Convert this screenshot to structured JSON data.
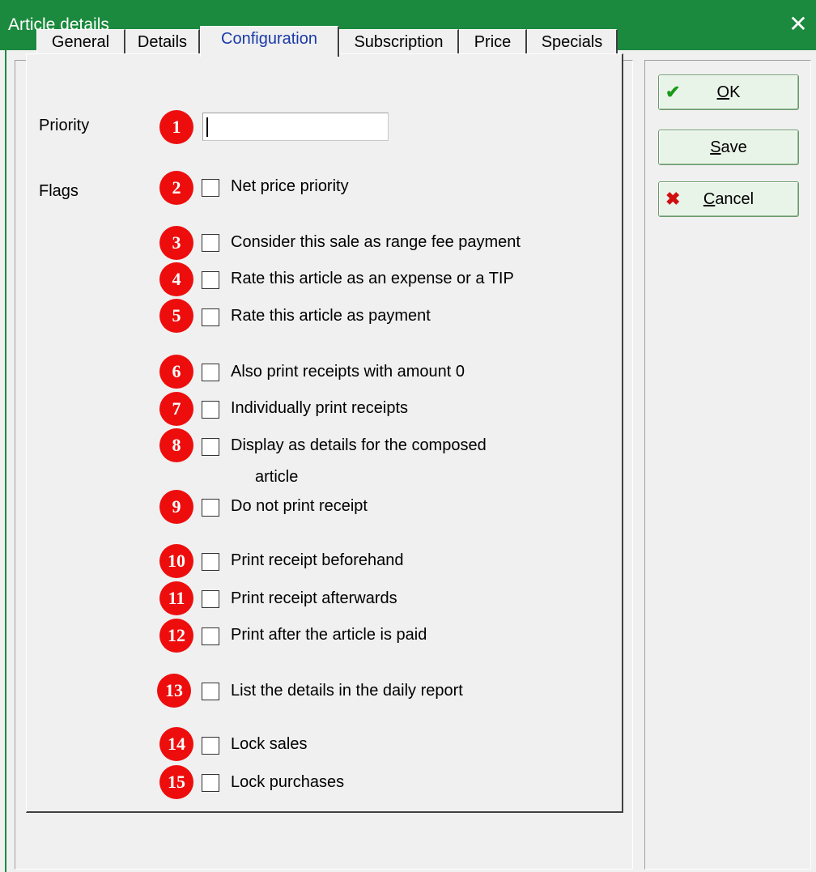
{
  "window": {
    "title": "Article details",
    "close_glyph": "✕"
  },
  "tabs": [
    {
      "label": "General"
    },
    {
      "label": "Details"
    },
    {
      "label": "Configuration",
      "active": true
    },
    {
      "label": "Subscription"
    },
    {
      "label": "Price"
    },
    {
      "label": "Specials"
    }
  ],
  "fields": {
    "priority_label": "Priority",
    "priority_value": "",
    "flags_label": "Flags"
  },
  "flags": [
    {
      "num": "1",
      "label": ""
    },
    {
      "num": "2",
      "label": "Net price priority",
      "checked": false
    },
    {
      "num": "3",
      "label": "Consider this sale as range fee payment",
      "checked": false
    },
    {
      "num": "4",
      "label": "Rate this article as an expense or a TIP",
      "checked": false
    },
    {
      "num": "5",
      "label": "Rate this article as payment",
      "checked": false
    },
    {
      "num": "6",
      "label": "Also print receipts with amount 0",
      "checked": false
    },
    {
      "num": "7",
      "label": "Individually print receipts",
      "checked": false
    },
    {
      "num": "8",
      "label": "Display as details for the composed",
      "label2": "article",
      "checked": false
    },
    {
      "num": "9",
      "label": "Do not print receipt",
      "checked": false
    },
    {
      "num": "10",
      "label": "Print receipt beforehand",
      "checked": false
    },
    {
      "num": "11",
      "label": "Print receipt afterwards",
      "checked": false
    },
    {
      "num": "12",
      "label": "Print after the article is paid",
      "checked": false
    },
    {
      "num": "13",
      "label": "List the details in the daily report",
      "checked": false
    },
    {
      "num": "14",
      "label": "Lock sales",
      "checked": false
    },
    {
      "num": "15",
      "label": "Lock purchases",
      "checked": false
    }
  ],
  "buttons": {
    "ok": {
      "label_u": "O",
      "label_rest": "K",
      "icon": "check-icon"
    },
    "save": {
      "label_u": "S",
      "label_rest": "ave"
    },
    "cancel": {
      "label_u": "C",
      "label_rest": "ancel",
      "icon": "x-icon"
    }
  },
  "colors": {
    "titlebar": "#1b8a3e",
    "badge": "#ee0d0d",
    "active_tab_text": "#1a3aa8",
    "ok_icon": "#1a9a1a",
    "cancel_icon": "#d01010"
  }
}
